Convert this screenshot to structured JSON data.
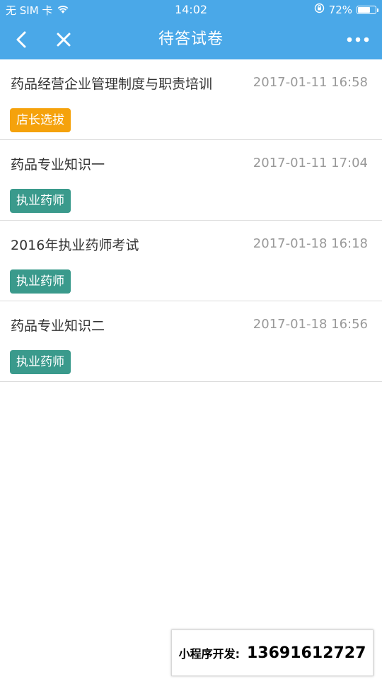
{
  "status_bar": {
    "carrier": "无 SIM 卡",
    "time": "14:02",
    "battery_percent_text": "72%",
    "battery_level": 0.72
  },
  "nav": {
    "title": "待答试卷",
    "back_icon": "chevron-left-icon",
    "close_icon": "close-icon",
    "more_icon": "more-dots-icon"
  },
  "colors": {
    "header": "#4aa8e8",
    "tag_orange": "#f5a20c",
    "tag_teal": "#3a9a8c",
    "title_text": "#333333",
    "date_text": "#999999"
  },
  "papers": [
    {
      "title": "药品经营企业管理制度与职责培训",
      "date": "2017-01-11 16:58",
      "tag": "店长选拔",
      "tag_color": "#f5a20c"
    },
    {
      "title": "药品专业知识一",
      "date": "2017-01-11 17:04",
      "tag": "执业药师",
      "tag_color": "#3a9a8c"
    },
    {
      "title": "2016年执业药师考试",
      "date": "2017-01-18 16:18",
      "tag": "执业药师",
      "tag_color": "#3a9a8c"
    },
    {
      "title": "药品专业知识二",
      "date": "2017-01-18 16:56",
      "tag": "执业药师",
      "tag_color": "#3a9a8c"
    }
  ],
  "promo": {
    "label": "小程序开发:",
    "phone": "13691612727"
  }
}
